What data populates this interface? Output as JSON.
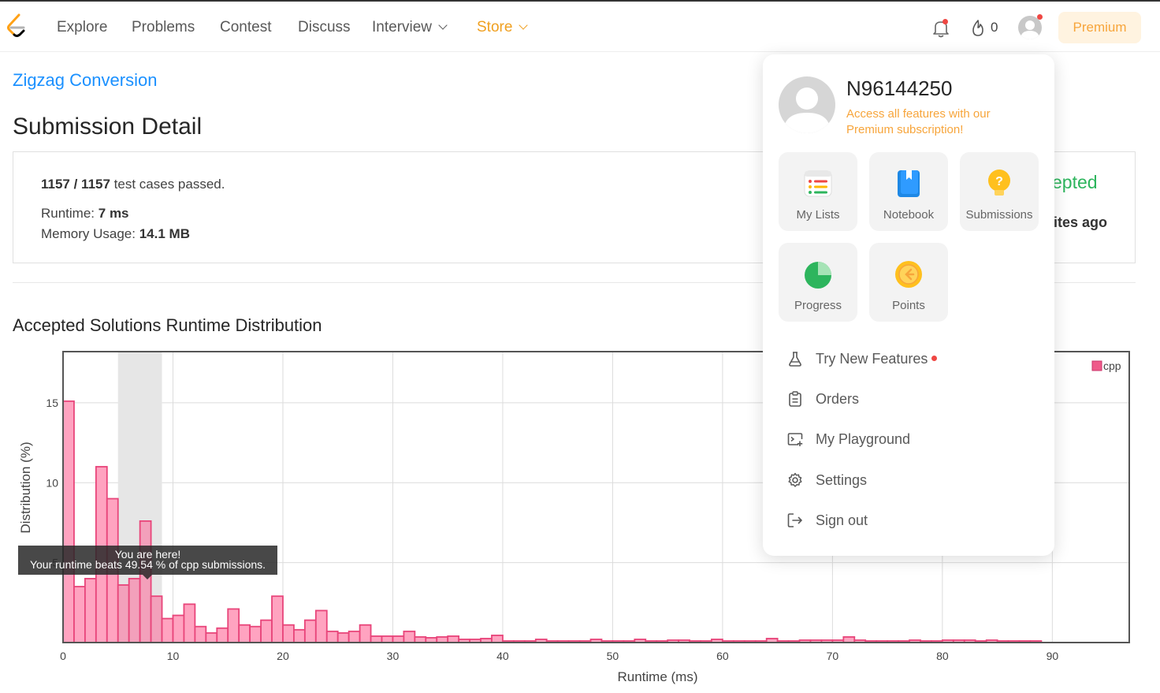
{
  "nav": {
    "items": [
      "Explore",
      "Problems",
      "Contest",
      "Discuss",
      "Interview",
      "Store"
    ],
    "streak_count": "0",
    "premium_label": "Premium"
  },
  "problem": {
    "title": "Zigzag Conversion"
  },
  "page_title": "Submission Detail",
  "detail": {
    "passed": "1157 / 1157",
    "passed_suffix": "test cases passed.",
    "runtime_label": "Runtime:",
    "runtime_value": "7 ms",
    "memory_label": "Memory Usage:",
    "memory_value": "14.1 MB",
    "status": "Accepted",
    "status_visible": "epted",
    "time_ago_visible": "ites ago"
  },
  "distribution_title": "Accepted Solutions Runtime Distribution",
  "tooltip": {
    "line1": "You are here!",
    "line2": "Your runtime beats 49.54 % of cpp submissions."
  },
  "chart_data": {
    "type": "bar",
    "xlabel": "Runtime (ms)",
    "ylabel": "Distribution (%)",
    "legend": [
      "cpp"
    ],
    "legend_position": "top-right",
    "xlim": [
      0,
      97
    ],
    "ylim": [
      0,
      18.2
    ],
    "xticks": [
      0,
      10,
      20,
      30,
      40,
      50,
      60,
      70,
      80,
      90
    ],
    "yticks": [
      5,
      10,
      15
    ],
    "highlight_range": [
      5,
      9
    ],
    "colors": {
      "bar_fill": "#ffa3c0",
      "bar_stroke": "#e8457a",
      "highlight": "#e6e6e6"
    },
    "series": [
      {
        "name": "cpp",
        "bin_width": 1,
        "values": [
          15.1,
          3.5,
          4.0,
          11.0,
          9.0,
          3.6,
          4.0,
          7.6,
          2.9,
          1.5,
          1.7,
          2.4,
          1.0,
          0.6,
          0.9,
          2.1,
          1.1,
          1.0,
          1.4,
          2.9,
          1.1,
          0.8,
          1.4,
          2.0,
          0.7,
          0.6,
          0.7,
          1.1,
          0.4,
          0.4,
          0.4,
          0.7,
          0.35,
          0.3,
          0.35,
          0.4,
          0.2,
          0.2,
          0.25,
          0.45,
          0.1,
          0.1,
          0.1,
          0.2,
          0.1,
          0.1,
          0.1,
          0.1,
          0.2,
          0.1,
          0.1,
          0.1,
          0.2,
          0.1,
          0.1,
          0.15,
          0.15,
          0.1,
          0.1,
          0.2,
          0.1,
          0.1,
          0.1,
          0.1,
          0.25,
          0.1,
          0.1,
          0.15,
          0.15,
          0.15,
          0.15,
          0.35,
          0.15,
          0.1,
          0.1,
          0.1,
          0.1,
          0.15,
          0.1,
          0.1,
          0.15,
          0.15,
          0.15,
          0.1,
          0.15,
          0.1,
          0.1,
          0.1,
          0.1
        ]
      }
    ]
  },
  "dropdown": {
    "username": "N96144250",
    "subtitle": "Access all features with our Premium subscription!",
    "tiles": [
      "My Lists",
      "Notebook",
      "Submissions",
      "Progress",
      "Points"
    ],
    "menu": [
      "Try New Features",
      "Orders",
      "My Playground",
      "Settings",
      "Sign out"
    ]
  }
}
